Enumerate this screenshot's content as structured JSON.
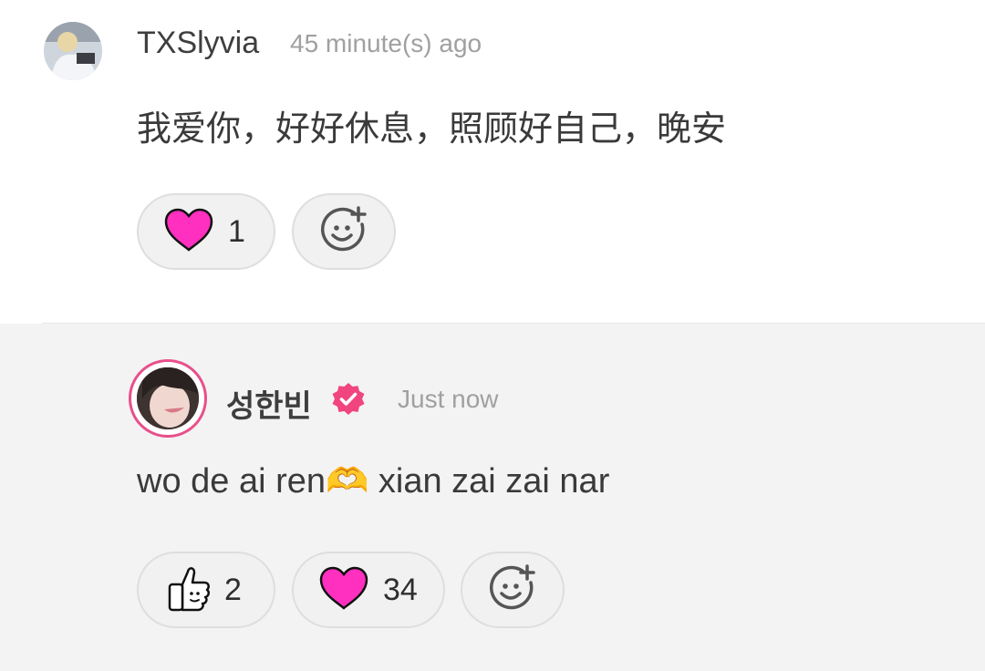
{
  "comments": [
    {
      "username": "TXSlyvia",
      "timestamp": "45 minute(s) ago",
      "text": "我爱你，好好休息，照顾好自己，晚安",
      "reactions": [
        {
          "icon": "heart-icon",
          "count": "1"
        },
        {
          "icon": "add-reaction-icon"
        }
      ]
    },
    {
      "username": "성한빈",
      "verified_icon": "verified-badge-icon",
      "timestamp": "Just now",
      "text": "wo de ai ren🫶 xian zai zai nar",
      "reactions": [
        {
          "icon": "thumbs-up-icon",
          "count": "2"
        },
        {
          "icon": "heart-icon",
          "count": "34"
        },
        {
          "icon": "add-reaction-icon"
        }
      ]
    }
  ],
  "colors": {
    "heart": "#ff2fbf",
    "verified": "#f0457e",
    "avatar_ring": "#e8508b",
    "reply_background": "#f3f3f3"
  }
}
